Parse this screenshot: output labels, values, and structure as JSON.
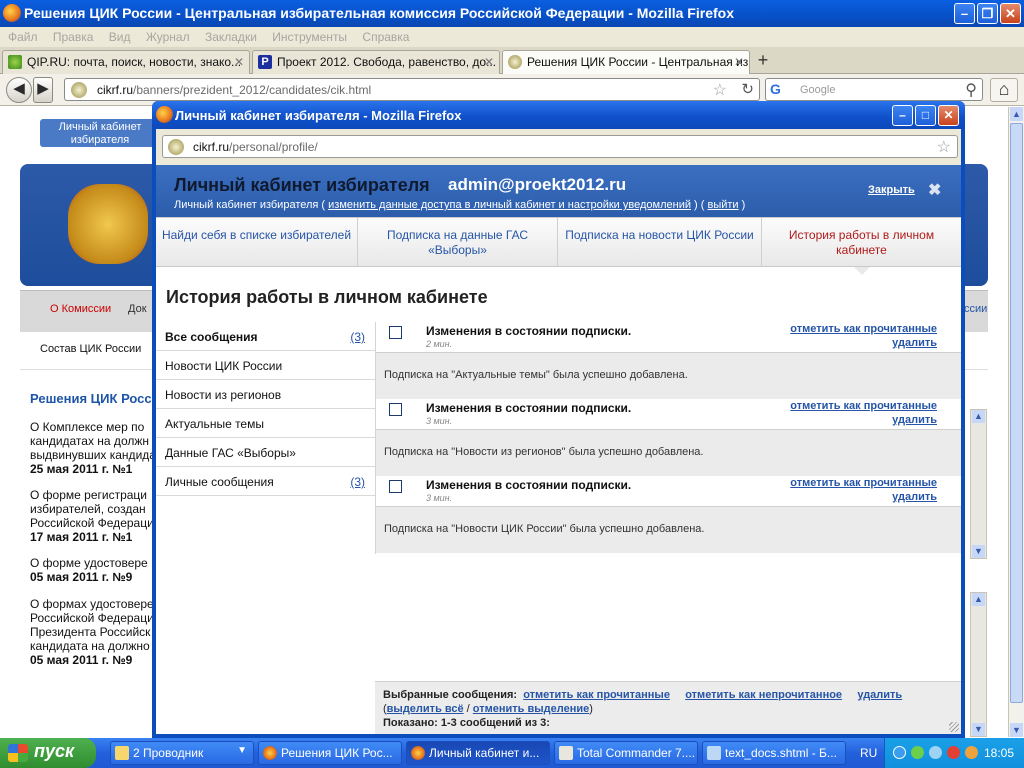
{
  "browser": {
    "title": "Решения ЦИК России - Центральная избирательная комиссия Российской Федерации - Mozilla Firefox",
    "menu": [
      "Файл",
      "Правка",
      "Вид",
      "Журнал",
      "Закладки",
      "Инструменты",
      "Справка"
    ],
    "tabs": [
      {
        "label": "QIP.RU: почта, поиск, новости, знако...",
        "active": false
      },
      {
        "label": "Проект 2012. Свобода, равенство, до...",
        "active": false
      },
      {
        "label": "Решения ЦИК России - Центральная из...",
        "active": true
      }
    ],
    "url_domain": "cikrf.ru",
    "url_path": "/banners/prezident_2012/candidates/cik.html",
    "search_placeholder": "Google"
  },
  "background_page": {
    "top_tab": "Личный кабинет избирателя",
    "menu_item_1": "О Комиссии",
    "menu_item_2": "Док",
    "menu_item_3": "ссии",
    "submenu": "Состав ЦИК России",
    "heading": "Решения ЦИК Росс",
    "items": [
      {
        "text": "О Комплексе мер по кандидатах на должн выдвинувших кандида",
        "date": "25 мая 2011 г. №1"
      },
      {
        "text": "О форме регистраци избирателей, создан Российской Федераци",
        "date": "17 мая 2011 г. №1"
      },
      {
        "text": "О форме удостовере",
        "date": "05 мая 2011 г. №9"
      },
      {
        "text": "О формах удостовере Российской Федераци Президента Российск кандидата на должно",
        "date": "05 мая 2011 г. №9"
      }
    ]
  },
  "popup": {
    "title": "Личный кабинет избирателя - Mozilla Firefox",
    "url_domain": "cikrf.ru",
    "url_path": "/personal/profile/",
    "header": {
      "title": "Личный кабинет избирателя",
      "user": "admin@proekt2012.ru",
      "sub_prefix": "Личный кабинет избирателя (",
      "sub_link": "изменить данные доступа в личный кабинет и настройки уведомлений",
      "sub_mid": ") (",
      "sub_logout": "выйти",
      "sub_suffix": ")",
      "close_label": "Закрыть"
    },
    "tabs": [
      {
        "label": "Найди себя в списке избирателей",
        "active": false
      },
      {
        "label": "Подписка на данные ГАС «Выборы»",
        "active": false
      },
      {
        "label": "Подписка на новости ЦИК России",
        "active": false
      },
      {
        "label": "История работы в личном кабинете",
        "active": true
      }
    ],
    "page_title": "История работы в личном кабинете",
    "sidebar": [
      {
        "label": "Все сообщения",
        "count": "(3)"
      },
      {
        "label": "Новости ЦИК России",
        "count": ""
      },
      {
        "label": "Новости из регионов",
        "count": ""
      },
      {
        "label": "Актуальные темы",
        "count": ""
      },
      {
        "label": "Данные ГАС «Выборы»",
        "count": ""
      },
      {
        "label": "Личные сообщения",
        "count": "(3)"
      }
    ],
    "messages": [
      {
        "title": "Изменения в состоянии подписки.",
        "time": "2 мин.",
        "mark": "отметить как прочитанные",
        "delete": "удалить",
        "body": "Подписка на \"Актуальные темы\" была успешно добавлена."
      },
      {
        "title": "Изменения в состоянии подписки.",
        "time": "3 мин.",
        "mark": "отметить как прочитанные",
        "delete": "удалить",
        "body": "Подписка на \"Новости из регионов\" была успешно добавлена."
      },
      {
        "title": "Изменения в состоянии подписки.",
        "time": "3 мин.",
        "mark": "отметить как прочитанные",
        "delete": "удалить",
        "body": "Подписка на \"Новости ЦИК России\" была успешно добавлена."
      }
    ],
    "footer": {
      "selected_label": "Выбранные сообщения:",
      "mark_read": "отметить как прочитанные",
      "mark_unread": "отметить как непрочитанное",
      "delete": "удалить",
      "select_all": "выделить всё",
      "sep": "/",
      "deselect": "отменить выделение",
      "shown": "Показано: 1-3 сообщений из 3:"
    }
  },
  "taskbar": {
    "start": "пуск",
    "items": [
      "2 Проводник",
      "Решения ЦИК Рос...",
      "Личный кабинет и...",
      "Total Commander 7....",
      "text_docs.shtml - Б..."
    ],
    "lang": "RU",
    "clock": "18:05"
  }
}
